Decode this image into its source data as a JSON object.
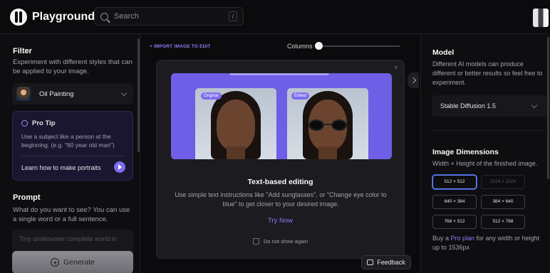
{
  "header": {
    "app_name": "Playground",
    "search_placeholder": "Search",
    "search_shortcut": "/"
  },
  "filter": {
    "title": "Filter",
    "description": "Experiment with different styles that can be applied to your image.",
    "selected": "Oil Painting",
    "protip": {
      "title": "Pro Tip",
      "text": "Use a subject like a person at the beginning. (e.g. \"60 year old man\")",
      "link": "Learn how to make portraits"
    }
  },
  "prompt": {
    "title": "Prompt",
    "description": "What do you want to see? You can use a single word or a full sentence.",
    "placeholder": "Tiny underwater complete world in",
    "generate_label": "Generate"
  },
  "canvas": {
    "import_label": "+ IMPORT IMAGE TO EDIT",
    "columns_label": "Columns",
    "columns_value": 0
  },
  "modal": {
    "close_glyph": "×",
    "badge_original": "Original",
    "badge_edited": "Edited",
    "title": "Text-based editing",
    "text": "Use simple text instructions like \"Add sunglasses\", or \"Change eye color to blue\" to get closer to your desired image.",
    "cta": "Try Now",
    "dont_show": "Do not show again"
  },
  "feedback": {
    "label": "Feedback"
  },
  "model": {
    "title": "Model",
    "description": "Different AI models can produce different or better results so feel free to experiment.",
    "selected": "Stable Diffusion 1.5"
  },
  "dimensions": {
    "title": "Image Dimensions",
    "description": "Width × Height of the finished image.",
    "options": [
      "512 × 512",
      "1024 × 1024",
      "640 × 384",
      "384 × 640",
      "768 × 512",
      "512 × 768"
    ],
    "selected": "512 × 512",
    "buy_prefix": "Buy a ",
    "buy_link": "Pro plan",
    "buy_suffix": " for any width or height up to 1536px"
  },
  "colors": {
    "accent": "#7c6cf0",
    "link": "#8b7cf6",
    "background": "#0b0b0d"
  }
}
